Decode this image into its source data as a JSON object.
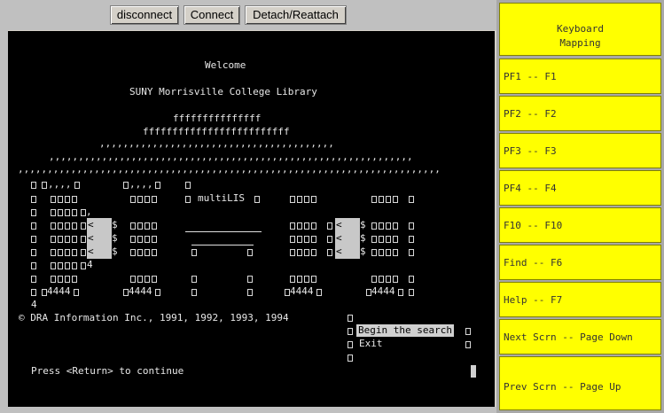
{
  "toolbar": {
    "disconnect": "disconnect",
    "connect": "Connect",
    "detach": "Detach/Reattach"
  },
  "terminal": {
    "welcome": "Welcome",
    "library": "SUNY Morrisville College Library",
    "art1": "fffffffffffffff",
    "art2": "fffffffffffffffffffffffff",
    "art3": ",,,,,,,,,,,,,,,,,,,,,,,,,,,,,,,,,,,,,,,,",
    "art4": ",,,,,,,,,,,,,,,,,,,,,,,,,,,,,,,,,,,,,,,,,,,,,,,,,,,,,,,,,,,,,,",
    "art5": ",,,,,,,,,,,,,,,,,,,,,,,,,,,,,,,,,,,,,,,,,,,,,,,,,,,,,,,,,,,,,,,,,,,,,,,,",
    "multilis": "multiLIS",
    "copyright": "© DRA Information Inc., 1991, 1992, 1993, 1994",
    "menu_begin": "Begin the search",
    "menu_exit": "Exit",
    "prompt": "Press <Return> to continue",
    "r1a": ",,,,",
    "r1b": ",,,,",
    "comma": ",",
    "four": "4",
    "four2": "4",
    "dash": "4444",
    "glyph_lt": "<",
    "glyph_s": "$"
  },
  "keymap": {
    "title": "Keyboard\nMapping",
    "items": [
      "PF1 -- F1",
      "PF2 -- F2",
      "PF3 -- F3",
      "PF4 -- F4",
      "F10 -- F10",
      "Find -- F6",
      "Help -- F7",
      "Next Scrn -- Page Down",
      "Prev Scrn -- Page Up"
    ]
  }
}
